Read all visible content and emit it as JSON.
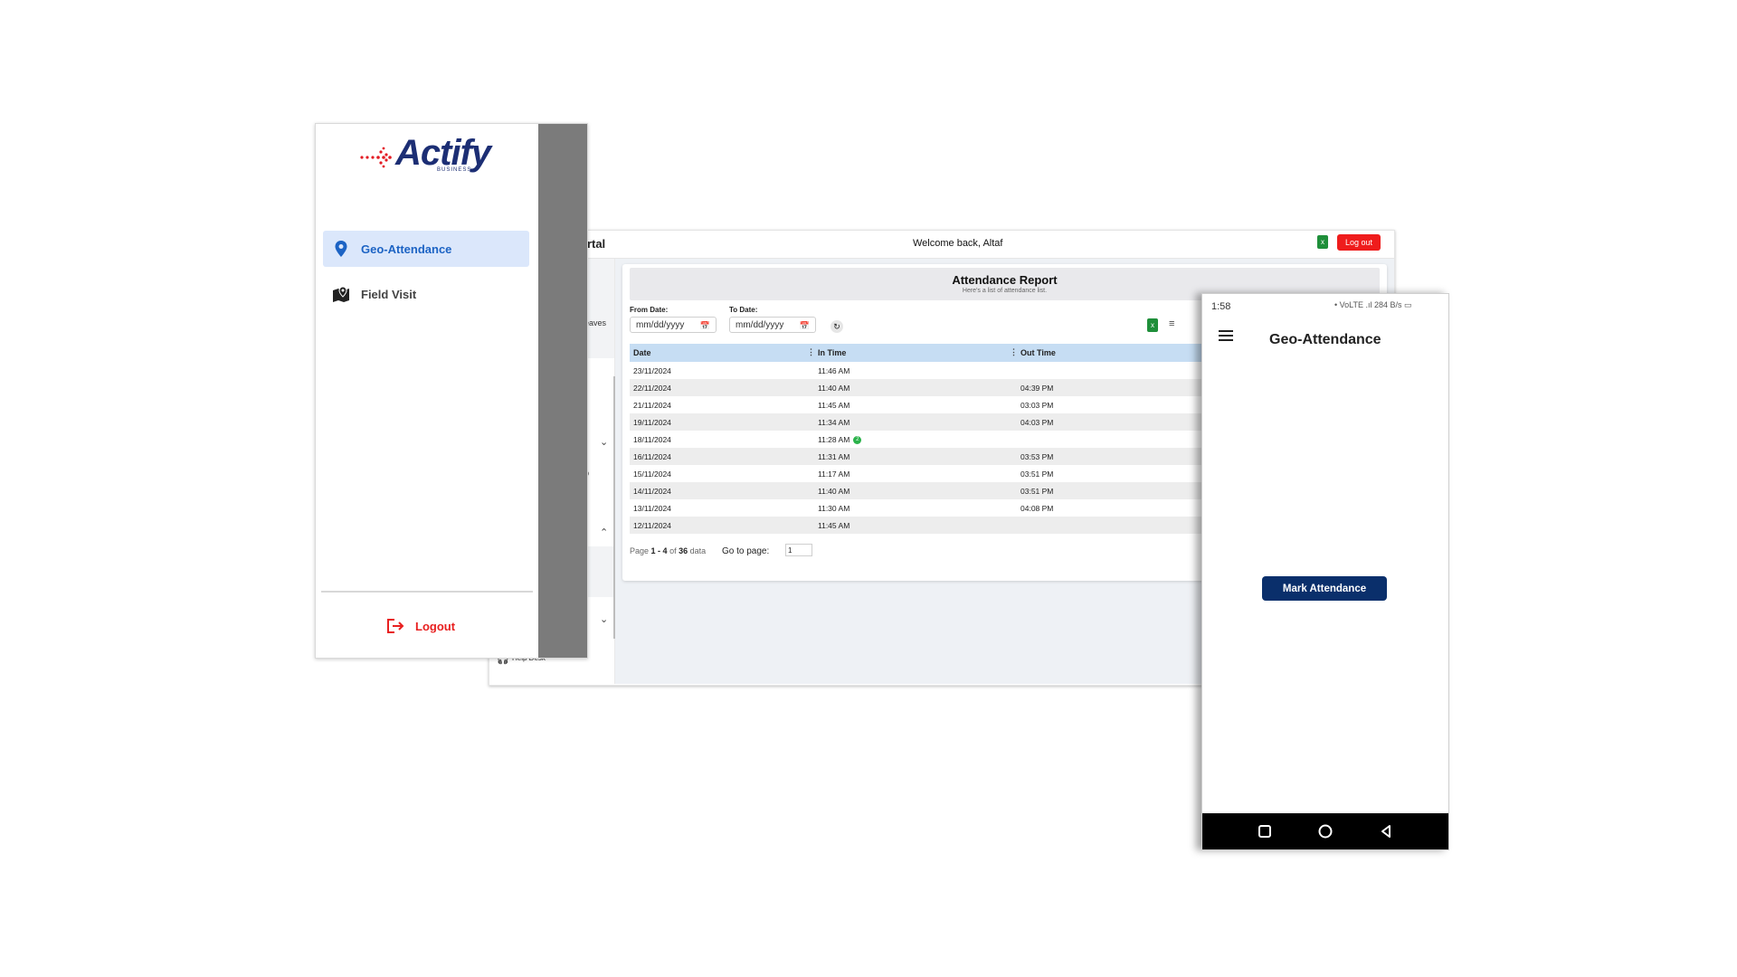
{
  "colors": {
    "brand_navy": "#1c2e74",
    "active_blue": "#1c63c4",
    "logout_red": "#e82020",
    "table_header": "#c6ddf3",
    "mark_button": "#0a2f6b",
    "excel_green": "#1f8f3a"
  },
  "drawer": {
    "logo": {
      "text": "Actify",
      "subtitle": "BUSINESS"
    },
    "nav": [
      {
        "label": "Geo-Attendance",
        "icon": "location-pin-icon",
        "active": true
      },
      {
        "label": "Field Visit",
        "icon": "map-marker-icon",
        "active": false
      }
    ],
    "logout_label": "Logout"
  },
  "portal": {
    "brand_partial": "ortal",
    "welcome": "Welcome back, Altaf",
    "logout_button": "Log out",
    "sidebar": {
      "leaves_partial": "Leaves",
      "job_partial": "ob",
      "help_desk": "Help Desk"
    },
    "report": {
      "title": "Attendance Report",
      "subtitle": "Here's a list of attendance list.",
      "from_label": "From Date:",
      "to_label": "To Date:",
      "date_placeholder": "mm/dd/yyyy",
      "columns": [
        "Date",
        "In Time",
        "Out Time"
      ],
      "rows": [
        {
          "date": "23/11/2024",
          "in": "11:46 AM",
          "out": ""
        },
        {
          "date": "22/11/2024",
          "in": "11:40 AM",
          "out": "04:39 PM"
        },
        {
          "date": "21/11/2024",
          "in": "11:45 AM",
          "out": "03:03 PM"
        },
        {
          "date": "19/11/2024",
          "in": "11:34 AM",
          "out": "04:03 PM"
        },
        {
          "date": "18/11/2024",
          "in": "11:28 AM",
          "out": "",
          "badge": "2"
        },
        {
          "date": "16/11/2024",
          "in": "11:31 AM",
          "out": "03:53 PM"
        },
        {
          "date": "15/11/2024",
          "in": "11:17 AM",
          "out": "03:51 PM"
        },
        {
          "date": "14/11/2024",
          "in": "11:40 AM",
          "out": "03:51 PM"
        },
        {
          "date": "13/11/2024",
          "in": "11:30 AM",
          "out": "04:08 PM"
        },
        {
          "date": "12/11/2024",
          "in": "11:45 AM",
          "out": ""
        }
      ],
      "pager": {
        "prefix": "Page",
        "range": "1 - 4",
        "of": "of",
        "total": "36",
        "suffix": "data"
      },
      "goto_label": "Go to page:",
      "goto_value": "1"
    }
  },
  "phone": {
    "status_time": "1:58",
    "status_icons_text": "• VoLTE .ıl 284 B/s ▭",
    "title": "Geo-Attendance",
    "mark_button": "Mark Attendance"
  }
}
